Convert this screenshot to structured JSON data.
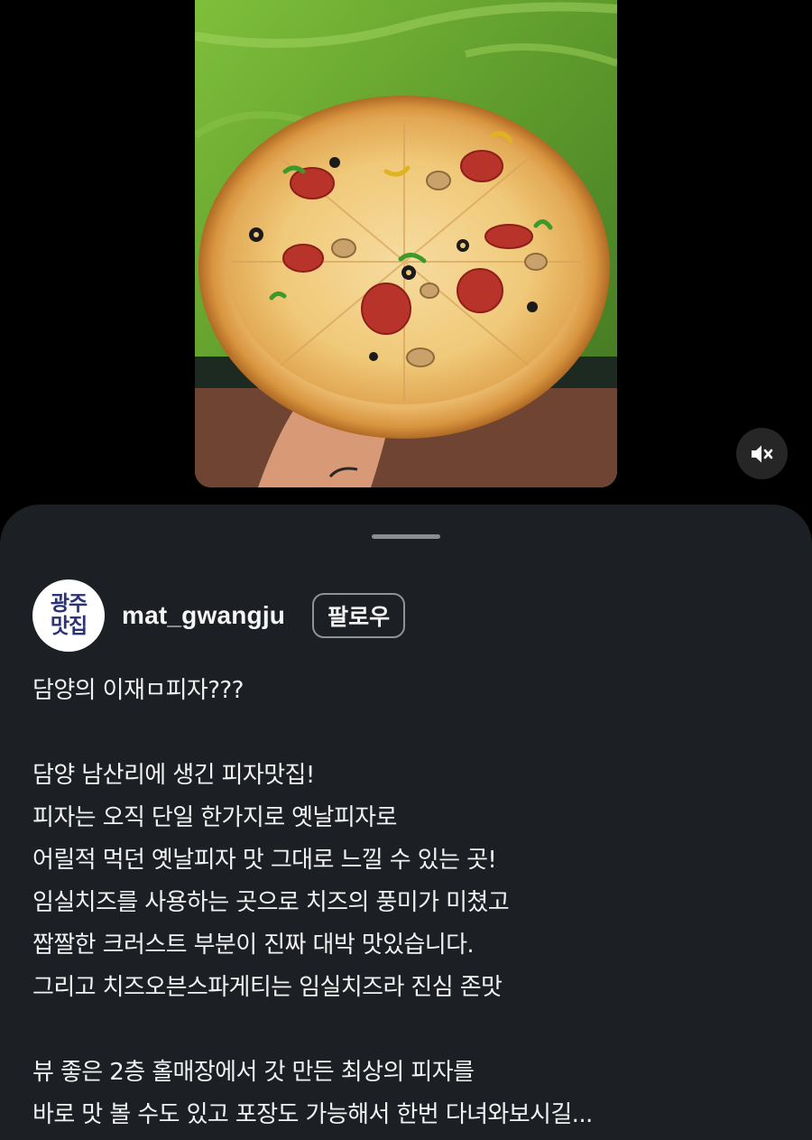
{
  "video": {
    "mute_icon": "speaker-muted-icon"
  },
  "post": {
    "avatar_lines": [
      "광주",
      "맛집"
    ],
    "username": "mat_gwangju",
    "follow_label": "팔로우",
    "caption_lines": [
      "담양의 이재ㅁ피자???",
      "",
      "담양 남산리에 생긴 피자맛집!",
      "피자는 오직 단일 한가지로 옛날피자로",
      "어릴적 먹던 옛날피자 맛 그대로 느낄 수 있는 곳!",
      "임실치즈를 사용하는 곳으로 치즈의 풍미가 미쳤고",
      "짭짤한 크러스트 부분이 진짜 대박 맛있습니다.",
      "그리고 치즈오븐스파게티는 임실치즈라 진심 존맛",
      "",
      "뷰 좋은 2층 홀매장에서 갓 만든 최상의 피자를",
      "바로 맛 볼 수도 있고 포장도 가능해서 한번 다녀와보시길..."
    ]
  },
  "colors": {
    "sheet_background": "#1c1f23",
    "text": "#f2f2f2",
    "avatar_text": "#2c3276"
  }
}
